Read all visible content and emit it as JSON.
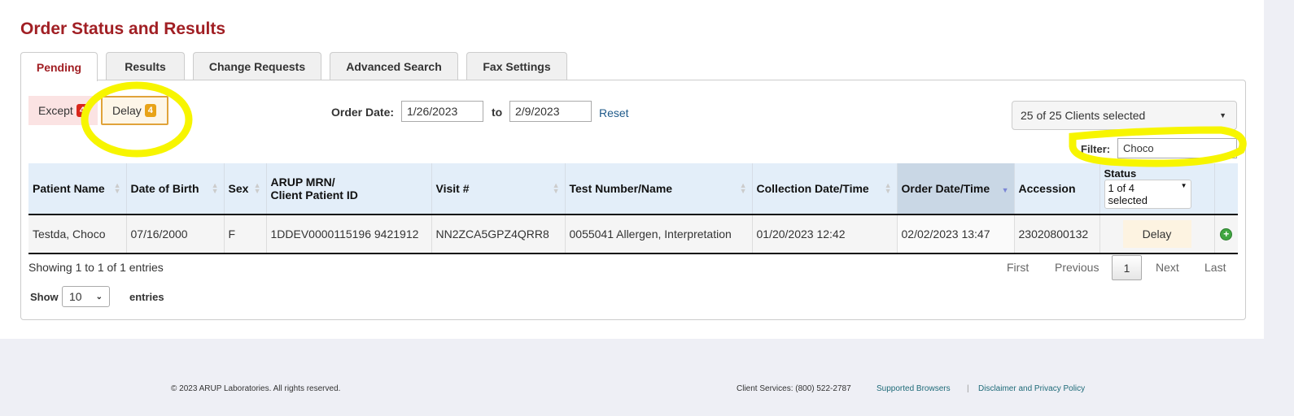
{
  "title": "Order Status and Results",
  "tabs": [
    "Pending",
    "Results",
    "Change Requests",
    "Advanced Search",
    "Fax Settings"
  ],
  "filters": {
    "except_label": "Except",
    "except_count": "4",
    "delay_label": "Delay",
    "delay_count": "4"
  },
  "order_date": {
    "label": "Order Date:",
    "from": "1/26/2023",
    "to_label": "to",
    "to": "2/9/2023",
    "reset": "Reset"
  },
  "clients": {
    "selected": "25 of 25 Clients selected"
  },
  "filter": {
    "label": "Filter:",
    "value": "Choco"
  },
  "table": {
    "headers": [
      "Patient Name",
      "Date of Birth",
      "Sex",
      "ARUP MRN/",
      "Client Patient ID",
      "Visit #",
      "Test Number/Name",
      "Collection Date/Time",
      "Order Date/Time",
      "Accession",
      "Status"
    ],
    "status_filter": "1 of 4 selected",
    "rows": [
      {
        "patient": "Testda, Choco",
        "dob": "07/16/2000",
        "sex": "F",
        "mrn": "1DDEV0000115196 9421912",
        "visit": "NN2ZCA5GPZ4QRR8",
        "test": "0055041 Allergen, Interpretation",
        "collection": "01/20/2023 12:42",
        "order": "02/02/2023 13:47",
        "accession": "23020800132",
        "status": "Delay"
      }
    ]
  },
  "info": "Showing 1 to 1 of 1 entries",
  "pagination": {
    "first": "First",
    "previous": "Previous",
    "current": "1",
    "next": "Next",
    "last": "Last"
  },
  "length": {
    "show": "Show",
    "value": "10",
    "entries": "entries"
  },
  "footer": {
    "copyright": "© 2023 ARUP Laboratories. All rights reserved.",
    "services": "Client Services: (800) 522-2787",
    "browsers": "Supported Browsers",
    "sep": "|",
    "privacy": "Disclaimer and Privacy Policy"
  },
  "colors": {
    "title": "#a11f24",
    "except_badge": "#d9261c",
    "delay_badge": "#e8a317",
    "highlight": "#f7f500"
  }
}
